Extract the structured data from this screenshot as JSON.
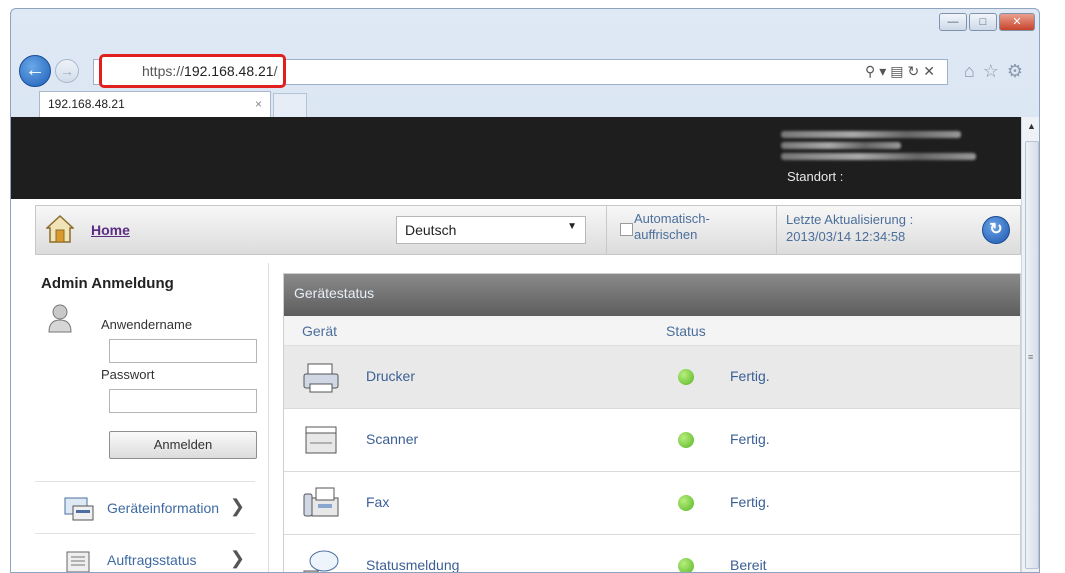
{
  "browser": {
    "url_prefix": "https://",
    "url_host": "192.168.48.21",
    "url_suffix": "/",
    "tab_title": "192.168.48.21",
    "tab_close": "×",
    "win_minimize": "—",
    "win_maximize": "□",
    "win_close": "✕"
  },
  "header": {
    "location_label": "Standort :"
  },
  "navbar": {
    "home_label": "Home",
    "language": "Deutsch",
    "auto_refresh_label": "Automatisch-auffrischen",
    "last_update_label": "Letzte Aktualisierung :",
    "last_update_value": "2013/03/14 12:34:58"
  },
  "sidebar": {
    "admin_title": "Admin Anmeldung",
    "username_label": "Anwendername",
    "password_label": "Passwort",
    "login_button": "Anmelden",
    "nav_items": [
      {
        "label": "Geräteinformation"
      },
      {
        "label": "Auftragsstatus"
      }
    ]
  },
  "status_panel": {
    "title": "Gerätestatus",
    "col_device": "Gerät",
    "col_status": "Status",
    "rows": [
      {
        "device": "Drucker",
        "status": "Fertig.",
        "icon": "printer-icon"
      },
      {
        "device": "Scanner",
        "status": "Fertig.",
        "icon": "scanner-icon"
      },
      {
        "device": "Fax",
        "status": "Fertig.",
        "icon": "fax-icon"
      },
      {
        "device": "Statusmeldung",
        "status": "Bereit",
        "icon": "status-message-icon"
      }
    ]
  },
  "colors": {
    "highlight_border": "#e0201f",
    "link": "#3b5f94",
    "status_ok": "#56b625"
  }
}
